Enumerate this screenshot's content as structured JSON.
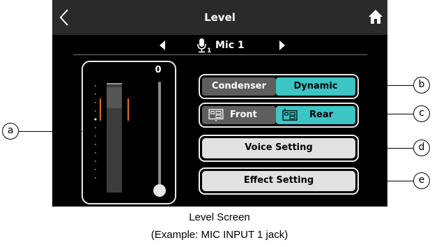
{
  "screen": {
    "title": "Level",
    "back_icon": "chevron-left-icon",
    "home_icon": "home-icon"
  },
  "channel_nav": {
    "mic_icon": "microphone-icon",
    "channel_number": "1",
    "channel_label": "Mic 1"
  },
  "meter": {
    "fader_value": "0",
    "fader_level": 0
  },
  "mic_type": {
    "options": [
      "Condenser",
      "Dynamic"
    ],
    "selected": "Dynamic"
  },
  "mount": {
    "options": [
      "Front",
      "Rear"
    ],
    "selected": "Rear"
  },
  "buttons": {
    "voice_setting": "Voice Setting",
    "effect_setting": "Effect Setting"
  },
  "callouts": [
    "a",
    "b",
    "c",
    "d",
    "e"
  ],
  "caption": {
    "line1": "Level Screen",
    "line2": "(Example: MIC INPUT 1 jack)"
  },
  "colors": {
    "accent": "#3cc5c5",
    "inactive": "#5e5e5e",
    "peak": "#e07020"
  }
}
